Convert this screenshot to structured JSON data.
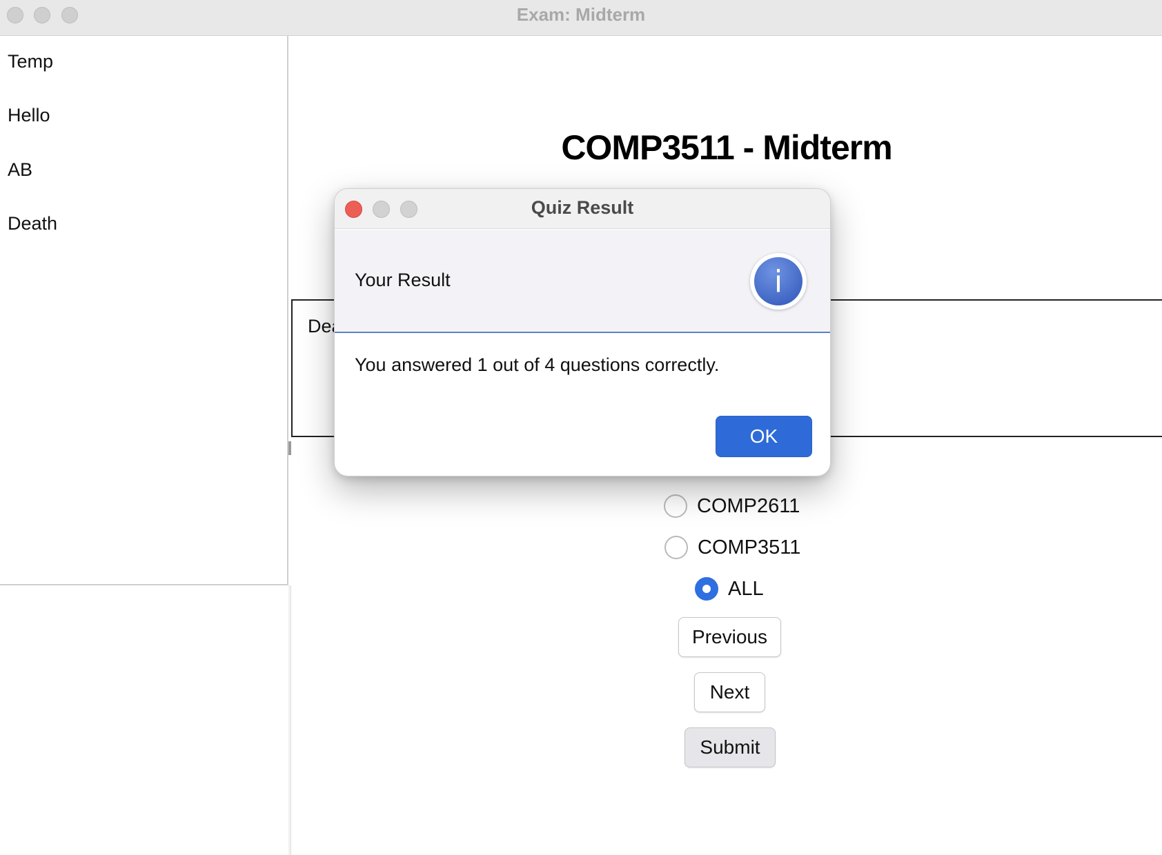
{
  "window": {
    "title": "Exam: Midterm"
  },
  "sidebar": {
    "items": [
      {
        "label": "Temp"
      },
      {
        "label": "Hello"
      },
      {
        "label": "AB"
      },
      {
        "label": "Death"
      }
    ]
  },
  "main": {
    "exam_title": "COMP3511 - Midterm",
    "question_text_partial": "Dea",
    "options": [
      {
        "label": "COMP2611",
        "selected": false
      },
      {
        "label": "COMP3511",
        "selected": false
      },
      {
        "label": "ALL",
        "selected": true
      }
    ],
    "buttons": {
      "previous": "Previous",
      "next": "Next",
      "submit": "Submit"
    }
  },
  "dialog": {
    "title": "Quiz Result",
    "header": "Your Result",
    "icon": "info-icon",
    "icon_glyph": "i",
    "message": "You answered 1 out of 4 questions correctly.",
    "ok_label": "OK"
  },
  "colors": {
    "accent": "#2e6bd8",
    "close_red": "#ec5f55",
    "radio_selected": "#2f6fe0"
  }
}
